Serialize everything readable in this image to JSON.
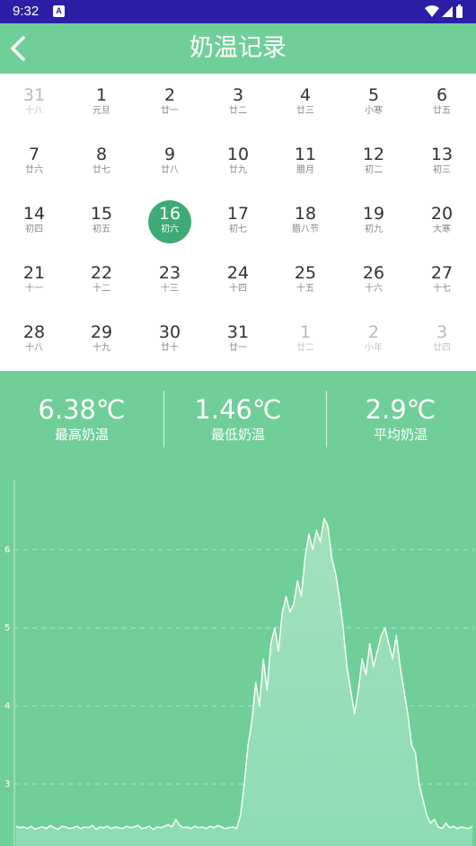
{
  "status_bar": {
    "time": "9:32",
    "notification": "A"
  },
  "header": {
    "title": "奶温记录"
  },
  "calendar": {
    "selected_index": 16,
    "days": [
      {
        "day": "31",
        "lunar": "十八",
        "other": true
      },
      {
        "day": "1",
        "lunar": "元旦",
        "other": false
      },
      {
        "day": "2",
        "lunar": "廿一",
        "other": false
      },
      {
        "day": "3",
        "lunar": "廿二",
        "other": false
      },
      {
        "day": "4",
        "lunar": "廿三",
        "other": false
      },
      {
        "day": "5",
        "lunar": "小寒",
        "other": false
      },
      {
        "day": "6",
        "lunar": "廿五",
        "other": false
      },
      {
        "day": "7",
        "lunar": "廿六",
        "other": false
      },
      {
        "day": "8",
        "lunar": "廿七",
        "other": false
      },
      {
        "day": "9",
        "lunar": "廿八",
        "other": false
      },
      {
        "day": "10",
        "lunar": "廿九",
        "other": false
      },
      {
        "day": "11",
        "lunar": "腊月",
        "other": false
      },
      {
        "day": "12",
        "lunar": "初二",
        "other": false
      },
      {
        "day": "13",
        "lunar": "初三",
        "other": false
      },
      {
        "day": "14",
        "lunar": "初四",
        "other": false
      },
      {
        "day": "15",
        "lunar": "初五",
        "other": false
      },
      {
        "day": "16",
        "lunar": "初六",
        "other": false
      },
      {
        "day": "17",
        "lunar": "初七",
        "other": false
      },
      {
        "day": "18",
        "lunar": "腊八节",
        "other": false
      },
      {
        "day": "19",
        "lunar": "初九",
        "other": false
      },
      {
        "day": "20",
        "lunar": "大寒",
        "other": false
      },
      {
        "day": "21",
        "lunar": "十一",
        "other": false
      },
      {
        "day": "22",
        "lunar": "十二",
        "other": false
      },
      {
        "day": "23",
        "lunar": "十三",
        "other": false
      },
      {
        "day": "24",
        "lunar": "十四",
        "other": false
      },
      {
        "day": "25",
        "lunar": "十五",
        "other": false
      },
      {
        "day": "26",
        "lunar": "十六",
        "other": false
      },
      {
        "day": "27",
        "lunar": "十七",
        "other": false
      },
      {
        "day": "28",
        "lunar": "十八",
        "other": false
      },
      {
        "day": "29",
        "lunar": "十九",
        "other": false
      },
      {
        "day": "30",
        "lunar": "廿十",
        "other": false
      },
      {
        "day": "31",
        "lunar": "廿一",
        "other": false
      },
      {
        "day": "1",
        "lunar": "廿二",
        "other": true
      },
      {
        "day": "2",
        "lunar": "小年",
        "other": true
      },
      {
        "day": "3",
        "lunar": "廿四",
        "other": true
      }
    ]
  },
  "stats": {
    "max_value": "6.38℃",
    "max_label": "最高奶温",
    "min_value": "1.46℃",
    "min_label": "最低奶温",
    "avg_value": "2.9℃",
    "avg_label": "平均奶温"
  },
  "colors": {
    "brand_green": "#70cf99",
    "selected_green": "#3eaa76",
    "status_bar": "#2d1ea8"
  },
  "chart_data": {
    "type": "area",
    "xlabel": "",
    "ylabel": "",
    "y_ticks": [
      "3",
      "4",
      "5",
      "6"
    ],
    "ylim": [
      2.2,
      6.9
    ],
    "grid": true,
    "values": [
      2.46,
      2.44,
      2.45,
      2.43,
      2.46,
      2.42,
      2.44,
      2.45,
      2.43,
      2.47,
      2.44,
      2.42,
      2.46,
      2.45,
      2.43,
      2.44,
      2.46,
      2.43,
      2.45,
      2.44,
      2.47,
      2.42,
      2.45,
      2.44,
      2.46,
      2.43,
      2.45,
      2.44,
      2.43,
      2.46,
      2.44,
      2.45,
      2.47,
      2.43,
      2.44,
      2.46,
      2.42,
      2.45,
      2.44,
      2.46,
      2.48,
      2.45,
      2.55,
      2.47,
      2.44,
      2.45,
      2.43,
      2.46,
      2.44,
      2.45,
      2.43,
      2.46,
      2.44,
      2.47,
      2.45,
      2.43,
      2.44,
      2.45,
      2.43,
      2.6,
      3.0,
      3.5,
      3.8,
      4.3,
      4.0,
      4.6,
      4.2,
      4.8,
      5.0,
      4.7,
      5.2,
      5.4,
      5.2,
      5.3,
      5.6,
      5.4,
      5.9,
      6.2,
      6.0,
      6.25,
      6.1,
      6.4,
      6.3,
      5.9,
      5.7,
      5.4,
      5.0,
      4.5,
      4.2,
      3.9,
      4.2,
      4.6,
      4.4,
      4.8,
      4.5,
      4.7,
      4.9,
      5.0,
      4.8,
      4.6,
      4.9,
      4.5,
      4.2,
      3.9,
      3.5,
      3.4,
      3.0,
      2.8,
      2.6,
      2.5,
      2.55,
      2.45,
      2.43,
      2.5,
      2.44,
      2.46,
      2.43,
      2.45,
      2.44,
      2.43,
      2.46
    ]
  }
}
